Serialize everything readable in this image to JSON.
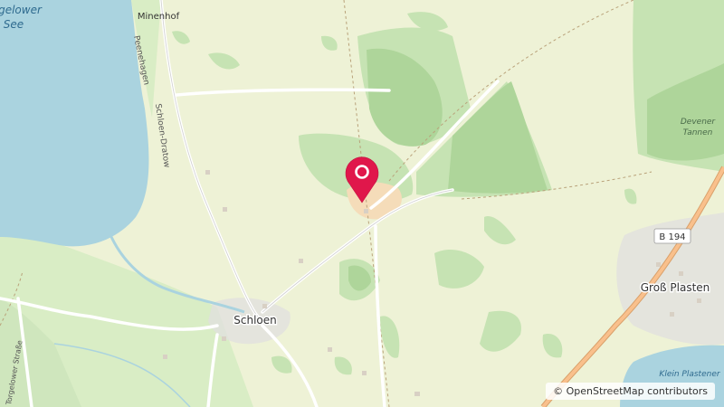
{
  "map": {
    "places": {
      "minenhof": "Minenhof",
      "schloen": "Schloen",
      "gross_plasten": "Groß Plasten"
    },
    "water": {
      "lake_line1": "gelower",
      "lake_line2": "See",
      "klein_plastener": "Klein Plastener"
    },
    "forest": {
      "devener_line1": "Devener",
      "devener_line2": "Tannen"
    },
    "roads": {
      "peenehagen": "Peenehagen",
      "schloen_dratow": "Schloen-Dratow",
      "torgelower_strasse": "Torgelower Straße",
      "b194": "B 194"
    },
    "marker": {
      "icon": "map-pin-icon",
      "color": "#e0174b"
    },
    "colors": {
      "land": "#eef2d6",
      "forest": "#c6e3b3",
      "dense_forest": "#aed59a",
      "water": "#aad3df",
      "farmyard": "#f5dcb9",
      "residential": "#e0dfdf",
      "primary_road": "#f9c08c"
    }
  },
  "attribution": {
    "symbol": "©",
    "text": "OpenStreetMap contributors"
  }
}
